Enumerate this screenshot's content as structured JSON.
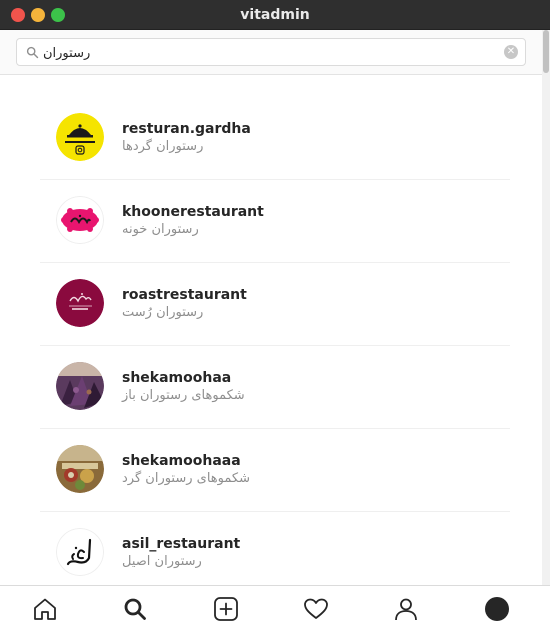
{
  "window": {
    "title": "vitadmin"
  },
  "search": {
    "value": "رستوران"
  },
  "results": [
    {
      "username": "resturan.gardha",
      "full_name": "رستوران گردها",
      "avatar_icon": "restaurant-cloche-logo"
    },
    {
      "username": "khoonerestaurant",
      "full_name": "رستوران خونه",
      "avatar_icon": "khooneh-logo"
    },
    {
      "username": "roastrestaurant",
      "full_name": "رستوران رُست",
      "avatar_icon": "roast-logo"
    },
    {
      "username": "shekamoohaa",
      "full_name": "شکموهای رستوران باز",
      "avatar_icon": "food-photo"
    },
    {
      "username": "shekamoohaaa",
      "full_name": "شکموهای رستوران گرد",
      "avatar_icon": "food-photo"
    },
    {
      "username": "asil_restaurant",
      "full_name": "رستوران اصیل",
      "avatar_icon": "asil-calligraphy-logo"
    }
  ],
  "bottom_nav": [
    "home-icon",
    "search-icon",
    "new-post-icon",
    "activity-heart-icon",
    "profile-icon",
    "profile-avatar"
  ]
}
